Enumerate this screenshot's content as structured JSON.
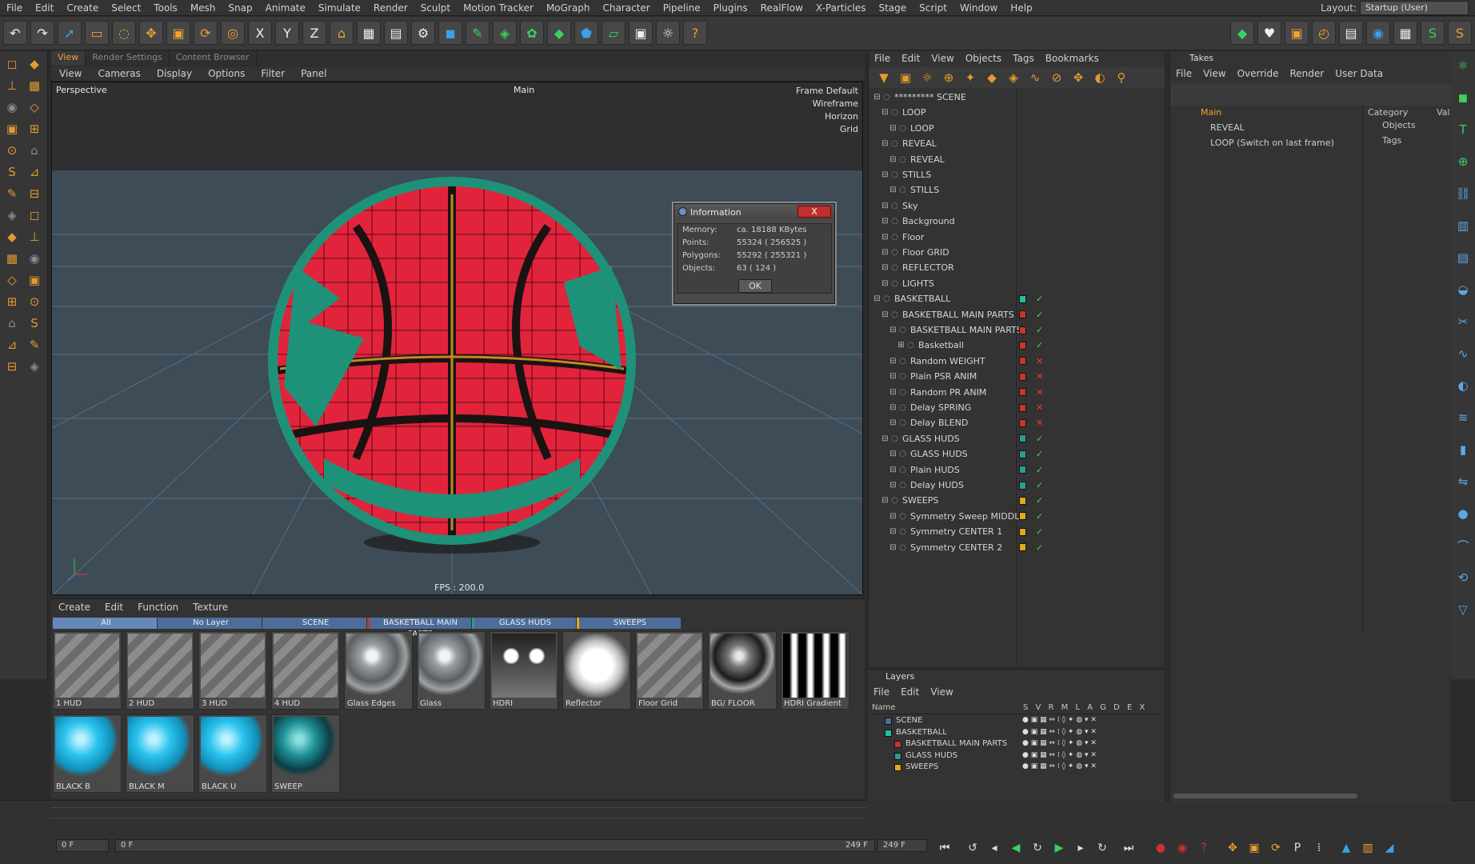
{
  "menubar": [
    "File",
    "Edit",
    "Create",
    "Select",
    "Tools",
    "Mesh",
    "Snap",
    "Animate",
    "Simulate",
    "Render",
    "Sculpt",
    "Motion Tracker",
    "MoGraph",
    "Character",
    "Pipeline",
    "Plugins",
    "RealFlow",
    "X-Particles",
    "Stage",
    "Script",
    "Window",
    "Help"
  ],
  "layout": {
    "label": "Layout:",
    "value": "Startup (User)"
  },
  "view_tabs": [
    "View",
    "Render Settings",
    "Content Browser"
  ],
  "view_menu": [
    "View",
    "Cameras",
    "Display",
    "Options",
    "Filter",
    "Panel"
  ],
  "viewport": {
    "camera": "Perspective",
    "render_view": "Main",
    "overlay": [
      "Frame Default",
      "Wireframe",
      "Horizon",
      "Grid"
    ],
    "fps": "FPS : 200.0"
  },
  "dialog": {
    "title": "Information",
    "close": "X",
    "rows": [
      {
        "label": "Memory:",
        "value": "ca. 18188 KBytes"
      },
      {
        "label": "Points:",
        "value": "55324 ( 256525 )"
      },
      {
        "label": "Polygons:",
        "value": "55292 ( 255321 )"
      },
      {
        "label": "Objects:",
        "value": "63 ( 124 )"
      }
    ],
    "ok": "OK"
  },
  "materials": {
    "menu": [
      "Create",
      "Edit",
      "Function",
      "Texture"
    ],
    "tabs": [
      {
        "label": "All",
        "color": "#6688bb"
      },
      {
        "label": "No Layer",
        "color": "#4d6d99"
      },
      {
        "label": "SCENE",
        "color": "#4d6d99"
      },
      {
        "label": "BASKETBALL MAIN PARTS",
        "color": "#c0392b"
      },
      {
        "label": "GLASS HUDS",
        "color": "#2a9d8f"
      },
      {
        "label": "SWEEPS",
        "color": "#e5a817"
      }
    ],
    "items": [
      {
        "name": "1 HUD",
        "kind": "stripe"
      },
      {
        "name": "2 HUD",
        "kind": "stripe"
      },
      {
        "name": "3 HUD",
        "kind": "stripe"
      },
      {
        "name": "4 HUD",
        "kind": "stripe"
      },
      {
        "name": "Glass Edges",
        "kind": "glass"
      },
      {
        "name": "Glass",
        "kind": "glass"
      },
      {
        "name": "HDRI",
        "kind": "hdri"
      },
      {
        "name": "Reflector",
        "kind": "reflector"
      },
      {
        "name": "Floor Grid",
        "kind": "stripe"
      },
      {
        "name": "BG/ FLOOR",
        "kind": "chrome"
      },
      {
        "name": "HDRI Gradient",
        "kind": "gradient"
      },
      {
        "name": "BLACK B",
        "kind": "cyan"
      },
      {
        "name": "BLACK M",
        "kind": "cyan"
      },
      {
        "name": "BLACK U",
        "kind": "cyan"
      },
      {
        "name": "SWEEP",
        "kind": "teal"
      }
    ]
  },
  "timeline": {
    "current": "0 F",
    "start": "0 F",
    "end_inner": "249 F",
    "end": "249 F"
  },
  "object_manager": {
    "menu": [
      "File",
      "Edit",
      "View",
      "Objects",
      "Tags",
      "Bookmarks"
    ],
    "rows": [
      {
        "name": "********* SCENE",
        "indent": 0,
        "color": ""
      },
      {
        "name": "LOOP",
        "indent": 1,
        "color": ""
      },
      {
        "name": "LOOP",
        "indent": 2,
        "color": ""
      },
      {
        "name": "REVEAL",
        "indent": 1,
        "color": ""
      },
      {
        "name": "REVEAL",
        "indent": 2,
        "color": ""
      },
      {
        "name": "STILLS",
        "indent": 1,
        "color": ""
      },
      {
        "name": "STILLS",
        "indent": 2,
        "color": ""
      },
      {
        "name": "Sky",
        "indent": 1,
        "color": ""
      },
      {
        "name": "Background",
        "indent": 1,
        "color": ""
      },
      {
        "name": "Floor",
        "indent": 1,
        "color": ""
      },
      {
        "name": "Floor GRID",
        "indent": 1,
        "color": ""
      },
      {
        "name": "REFLECTOR",
        "indent": 1,
        "color": ""
      },
      {
        "name": "LIGHTS",
        "indent": 1,
        "color": ""
      },
      {
        "name": "BASKETBALL",
        "indent": 0,
        "color": "#1fc0a0"
      },
      {
        "name": "BASKETBALL MAIN PARTS",
        "indent": 1,
        "color": "#c0392b"
      },
      {
        "name": "BASKETBALL MAIN PARTS",
        "indent": 2,
        "color": "#c0392b"
      },
      {
        "name": "Basketball",
        "indent": 3,
        "color": "#c0392b"
      },
      {
        "name": "Random WEIGHT",
        "indent": 2,
        "color": "#c0392b"
      },
      {
        "name": "Plain PSR ANIM",
        "indent": 2,
        "color": "#c0392b"
      },
      {
        "name": "Random PR ANIM",
        "indent": 2,
        "color": "#c0392b"
      },
      {
        "name": "Delay SPRING",
        "indent": 2,
        "color": "#c0392b"
      },
      {
        "name": "Delay BLEND",
        "indent": 2,
        "color": "#c0392b"
      },
      {
        "name": "GLASS HUDS",
        "indent": 1,
        "color": "#2a9d8f"
      },
      {
        "name": "GLASS HUDS",
        "indent": 2,
        "color": "#2a9d8f"
      },
      {
        "name": "Plain HUDS",
        "indent": 2,
        "color": "#2a9d8f"
      },
      {
        "name": "Delay HUDS",
        "indent": 2,
        "color": "#2a9d8f"
      },
      {
        "name": "SWEEPS",
        "indent": 1,
        "color": "#e5a817"
      },
      {
        "name": "Symmetry Sweep MIDDLE",
        "indent": 2,
        "color": "#e5a817"
      },
      {
        "name": "Symmetry CENTER 1",
        "indent": 2,
        "color": "#e5a817"
      },
      {
        "name": "Symmetry CENTER 2",
        "indent": 2,
        "color": "#e5a817"
      }
    ]
  },
  "takes": {
    "title": "Takes",
    "menu": [
      "File",
      "View",
      "Override",
      "Render",
      "User Data"
    ],
    "rows": [
      "Main",
      "REVEAL",
      "LOOP (Switch on last frame)"
    ],
    "category_header": "Category",
    "value_header": "Val",
    "categories": [
      "Objects",
      "Tags"
    ]
  },
  "layers": {
    "title": "Layers",
    "menu": [
      "File",
      "Edit",
      "View"
    ],
    "header": "Name",
    "cols": "S V R M L A G D E X",
    "rows": [
      {
        "name": "SCENE",
        "color": "#4d6d99",
        "indent": 1
      },
      {
        "name": "BASKETBALL",
        "color": "#1fc0a0",
        "indent": 1
      },
      {
        "name": "BASKETBALL MAIN PARTS",
        "color": "#c0392b",
        "indent": 2
      },
      {
        "name": "GLASS HUDS",
        "color": "#2a9d8f",
        "indent": 2
      },
      {
        "name": "SWEEPS",
        "color": "#e5a817",
        "indent": 2
      }
    ]
  }
}
